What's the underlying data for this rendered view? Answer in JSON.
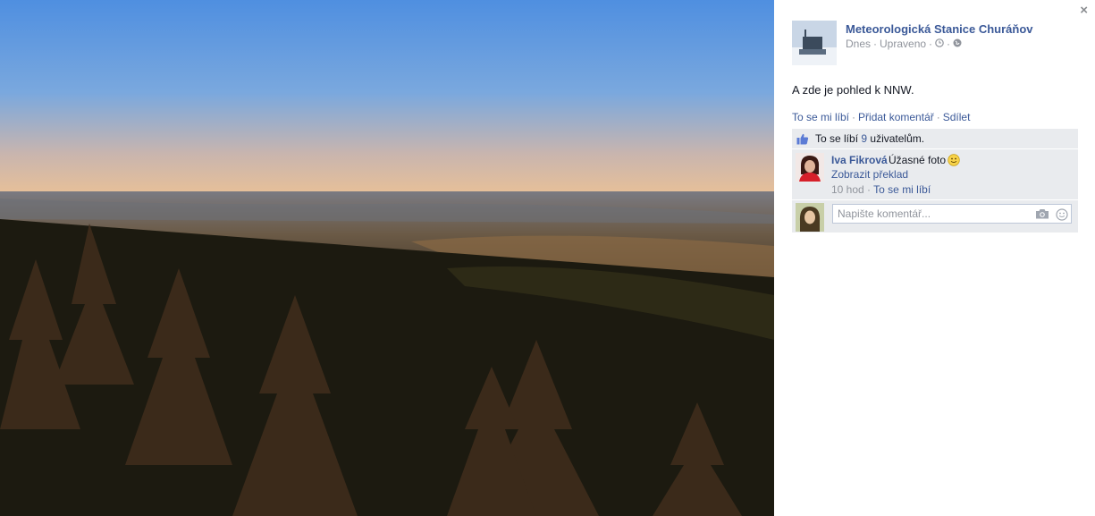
{
  "photo": {
    "icon": "landscape-photo"
  },
  "close": {
    "label": "×"
  },
  "post": {
    "page_name": "Meteorologická Stanice Churáňov",
    "date": "Dnes",
    "sep1": "·",
    "edited": "Upraveno",
    "sep2": "·",
    "sep3": "·",
    "text": "A zde je pohled k NNW."
  },
  "actions": {
    "like": "To se mi líbí",
    "sep1": "·",
    "comment": "Přidat komentář",
    "sep2": "·",
    "share": "Sdílet"
  },
  "likes": {
    "prefix": "To se líbí",
    "count": "9",
    "suffix": "uživatelům."
  },
  "comment": {
    "author": "Iva Fikrová",
    "text": "Úžasné foto",
    "translate": "Zobrazit překlad",
    "time": "10 hod",
    "sep": "·",
    "like": "To se mi líbí"
  },
  "reply": {
    "placeholder": "Napište komentář..."
  },
  "colors": {
    "link": "#3b5998",
    "muted": "#90949c",
    "ufi_bg": "#e9ebee"
  }
}
